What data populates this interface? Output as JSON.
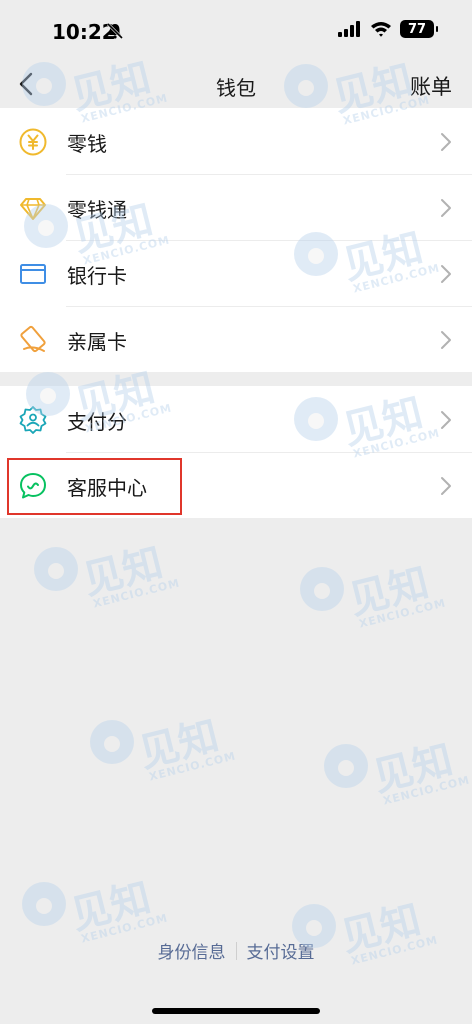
{
  "status_bar": {
    "time": "10:22",
    "battery": "77"
  },
  "nav": {
    "title": "钱包",
    "action": "账单"
  },
  "group1": [
    {
      "label": "零钱",
      "icon": "coin-yen-icon"
    },
    {
      "label": "零钱通",
      "icon": "diamond-icon"
    },
    {
      "label": "银行卡",
      "icon": "bank-card-icon"
    },
    {
      "label": "亲属卡",
      "icon": "family-card-icon"
    }
  ],
  "group2": [
    {
      "label": "支付分",
      "icon": "pay-score-icon"
    },
    {
      "label": "客服中心",
      "icon": "customer-service-icon"
    }
  ],
  "footer": {
    "link1": "身份信息",
    "link2": "支付设置"
  },
  "watermark": {
    "main": "见知",
    "sub": "XENCIO.COM"
  },
  "colors": {
    "background": "#ededed",
    "link": "#576b95",
    "highlight": "#e0362b",
    "coin": "#f0b92d",
    "card": "#3f8ee5",
    "service": "#07c160"
  }
}
